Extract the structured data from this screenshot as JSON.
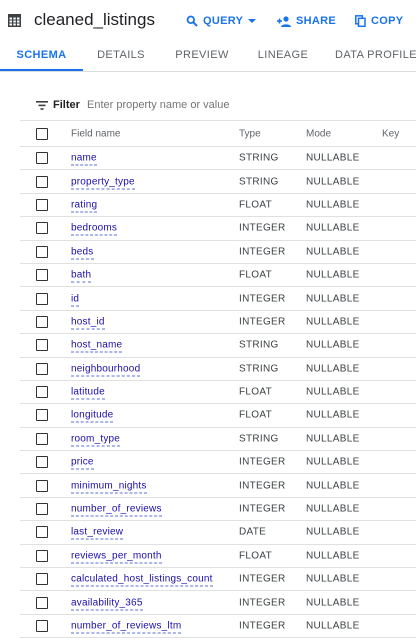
{
  "header": {
    "title": "cleaned_listings",
    "query_label": "QUERY",
    "share_label": "SHARE",
    "copy_label": "COPY",
    "accent": "#1a73e8"
  },
  "tabs": [
    {
      "label": "SCHEMA",
      "active": true
    },
    {
      "label": "DETAILS",
      "active": false
    },
    {
      "label": "PREVIEW",
      "active": false
    },
    {
      "label": "LINEAGE",
      "active": false
    },
    {
      "label": "DATA PROFILE",
      "active": false
    }
  ],
  "filter": {
    "label": "Filter",
    "placeholder": "Enter property name or value"
  },
  "columns": {
    "name": "Field name",
    "type": "Type",
    "mode": "Mode",
    "key": "Key"
  },
  "fields": [
    {
      "name": "name",
      "type": "STRING",
      "mode": "NULLABLE"
    },
    {
      "name": "property_type",
      "type": "STRING",
      "mode": "NULLABLE"
    },
    {
      "name": "rating",
      "type": "FLOAT",
      "mode": "NULLABLE"
    },
    {
      "name": "bedrooms",
      "type": "INTEGER",
      "mode": "NULLABLE"
    },
    {
      "name": "beds",
      "type": "INTEGER",
      "mode": "NULLABLE"
    },
    {
      "name": "bath",
      "type": "FLOAT",
      "mode": "NULLABLE"
    },
    {
      "name": "id",
      "type": "INTEGER",
      "mode": "NULLABLE"
    },
    {
      "name": "host_id",
      "type": "INTEGER",
      "mode": "NULLABLE"
    },
    {
      "name": "host_name",
      "type": "STRING",
      "mode": "NULLABLE"
    },
    {
      "name": "neighbourhood",
      "type": "STRING",
      "mode": "NULLABLE"
    },
    {
      "name": "latitude",
      "type": "FLOAT",
      "mode": "NULLABLE"
    },
    {
      "name": "longitude",
      "type": "FLOAT",
      "mode": "NULLABLE"
    },
    {
      "name": "room_type",
      "type": "STRING",
      "mode": "NULLABLE"
    },
    {
      "name": "price",
      "type": "INTEGER",
      "mode": "NULLABLE"
    },
    {
      "name": "minimum_nights",
      "type": "INTEGER",
      "mode": "NULLABLE"
    },
    {
      "name": "number_of_reviews",
      "type": "INTEGER",
      "mode": "NULLABLE"
    },
    {
      "name": "last_review",
      "type": "DATE",
      "mode": "NULLABLE"
    },
    {
      "name": "reviews_per_month",
      "type": "FLOAT",
      "mode": "NULLABLE"
    },
    {
      "name": "calculated_host_listings_count",
      "type": "INTEGER",
      "mode": "NULLABLE"
    },
    {
      "name": "availability_365",
      "type": "INTEGER",
      "mode": "NULLABLE"
    },
    {
      "name": "number_of_reviews_ltm",
      "type": "INTEGER",
      "mode": "NULLABLE"
    }
  ]
}
